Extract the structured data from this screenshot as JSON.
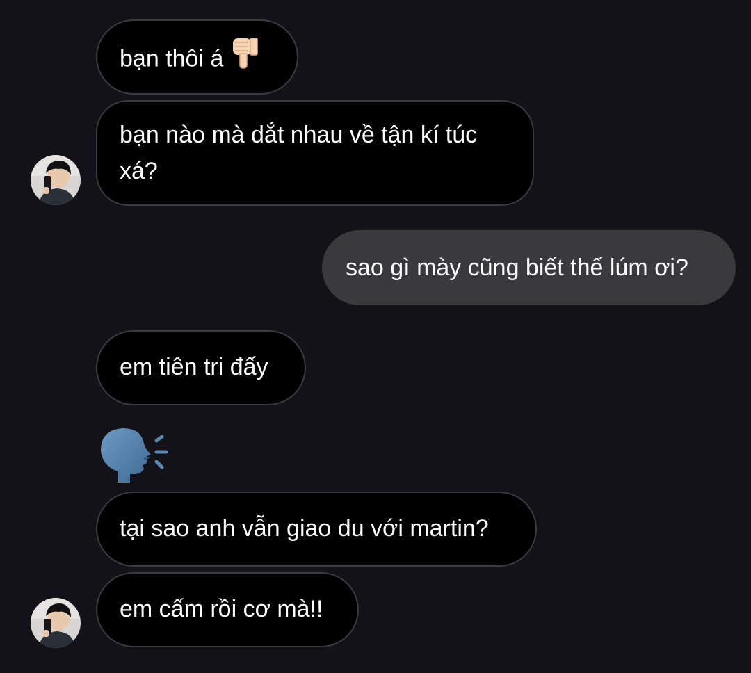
{
  "conversation": {
    "messages": [
      {
        "sender": "them",
        "text": "bạn thôi á",
        "emoji": "thumbs-down"
      },
      {
        "sender": "them",
        "text": "bạn nào mà dắt nhau về tận kí túc xá?"
      },
      {
        "sender": "me",
        "text": "sao gì mày cũng biết thế lúm ơi?"
      },
      {
        "sender": "them",
        "text": "em tiên tri đấy"
      },
      {
        "sender": "them",
        "emoji": "speaking-head"
      },
      {
        "sender": "them",
        "text": "tại sao anh vẫn giao du với martin?"
      },
      {
        "sender": "them",
        "text": "em cấm rồi cơ mà!!"
      }
    ]
  },
  "colors": {
    "background": "#121218",
    "incoming_bubble": "#000000",
    "incoming_border": "#3a3a40",
    "outgoing_bubble": "#3a3a3c",
    "text": "#ffffff"
  }
}
